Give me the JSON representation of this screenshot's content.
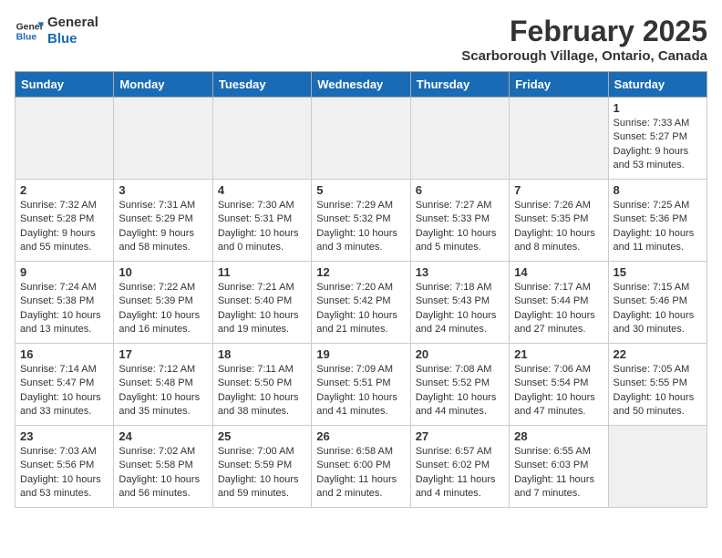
{
  "header": {
    "logo_line1": "General",
    "logo_line2": "Blue",
    "month_title": "February 2025",
    "location": "Scarborough Village, Ontario, Canada"
  },
  "weekdays": [
    "Sunday",
    "Monday",
    "Tuesday",
    "Wednesday",
    "Thursday",
    "Friday",
    "Saturday"
  ],
  "weeks": [
    [
      {
        "day": "",
        "info": ""
      },
      {
        "day": "",
        "info": ""
      },
      {
        "day": "",
        "info": ""
      },
      {
        "day": "",
        "info": ""
      },
      {
        "day": "",
        "info": ""
      },
      {
        "day": "",
        "info": ""
      },
      {
        "day": "1",
        "info": "Sunrise: 7:33 AM\nSunset: 5:27 PM\nDaylight: 9 hours and 53 minutes."
      }
    ],
    [
      {
        "day": "2",
        "info": "Sunrise: 7:32 AM\nSunset: 5:28 PM\nDaylight: 9 hours and 55 minutes."
      },
      {
        "day": "3",
        "info": "Sunrise: 7:31 AM\nSunset: 5:29 PM\nDaylight: 9 hours and 58 minutes."
      },
      {
        "day": "4",
        "info": "Sunrise: 7:30 AM\nSunset: 5:31 PM\nDaylight: 10 hours and 0 minutes."
      },
      {
        "day": "5",
        "info": "Sunrise: 7:29 AM\nSunset: 5:32 PM\nDaylight: 10 hours and 3 minutes."
      },
      {
        "day": "6",
        "info": "Sunrise: 7:27 AM\nSunset: 5:33 PM\nDaylight: 10 hours and 5 minutes."
      },
      {
        "day": "7",
        "info": "Sunrise: 7:26 AM\nSunset: 5:35 PM\nDaylight: 10 hours and 8 minutes."
      },
      {
        "day": "8",
        "info": "Sunrise: 7:25 AM\nSunset: 5:36 PM\nDaylight: 10 hours and 11 minutes."
      }
    ],
    [
      {
        "day": "9",
        "info": "Sunrise: 7:24 AM\nSunset: 5:38 PM\nDaylight: 10 hours and 13 minutes."
      },
      {
        "day": "10",
        "info": "Sunrise: 7:22 AM\nSunset: 5:39 PM\nDaylight: 10 hours and 16 minutes."
      },
      {
        "day": "11",
        "info": "Sunrise: 7:21 AM\nSunset: 5:40 PM\nDaylight: 10 hours and 19 minutes."
      },
      {
        "day": "12",
        "info": "Sunrise: 7:20 AM\nSunset: 5:42 PM\nDaylight: 10 hours and 21 minutes."
      },
      {
        "day": "13",
        "info": "Sunrise: 7:18 AM\nSunset: 5:43 PM\nDaylight: 10 hours and 24 minutes."
      },
      {
        "day": "14",
        "info": "Sunrise: 7:17 AM\nSunset: 5:44 PM\nDaylight: 10 hours and 27 minutes."
      },
      {
        "day": "15",
        "info": "Sunrise: 7:15 AM\nSunset: 5:46 PM\nDaylight: 10 hours and 30 minutes."
      }
    ],
    [
      {
        "day": "16",
        "info": "Sunrise: 7:14 AM\nSunset: 5:47 PM\nDaylight: 10 hours and 33 minutes."
      },
      {
        "day": "17",
        "info": "Sunrise: 7:12 AM\nSunset: 5:48 PM\nDaylight: 10 hours and 35 minutes."
      },
      {
        "day": "18",
        "info": "Sunrise: 7:11 AM\nSunset: 5:50 PM\nDaylight: 10 hours and 38 minutes."
      },
      {
        "day": "19",
        "info": "Sunrise: 7:09 AM\nSunset: 5:51 PM\nDaylight: 10 hours and 41 minutes."
      },
      {
        "day": "20",
        "info": "Sunrise: 7:08 AM\nSunset: 5:52 PM\nDaylight: 10 hours and 44 minutes."
      },
      {
        "day": "21",
        "info": "Sunrise: 7:06 AM\nSunset: 5:54 PM\nDaylight: 10 hours and 47 minutes."
      },
      {
        "day": "22",
        "info": "Sunrise: 7:05 AM\nSunset: 5:55 PM\nDaylight: 10 hours and 50 minutes."
      }
    ],
    [
      {
        "day": "23",
        "info": "Sunrise: 7:03 AM\nSunset: 5:56 PM\nDaylight: 10 hours and 53 minutes."
      },
      {
        "day": "24",
        "info": "Sunrise: 7:02 AM\nSunset: 5:58 PM\nDaylight: 10 hours and 56 minutes."
      },
      {
        "day": "25",
        "info": "Sunrise: 7:00 AM\nSunset: 5:59 PM\nDaylight: 10 hours and 59 minutes."
      },
      {
        "day": "26",
        "info": "Sunrise: 6:58 AM\nSunset: 6:00 PM\nDaylight: 11 hours and 2 minutes."
      },
      {
        "day": "27",
        "info": "Sunrise: 6:57 AM\nSunset: 6:02 PM\nDaylight: 11 hours and 4 minutes."
      },
      {
        "day": "28",
        "info": "Sunrise: 6:55 AM\nSunset: 6:03 PM\nDaylight: 11 hours and 7 minutes."
      },
      {
        "day": "",
        "info": ""
      }
    ]
  ]
}
